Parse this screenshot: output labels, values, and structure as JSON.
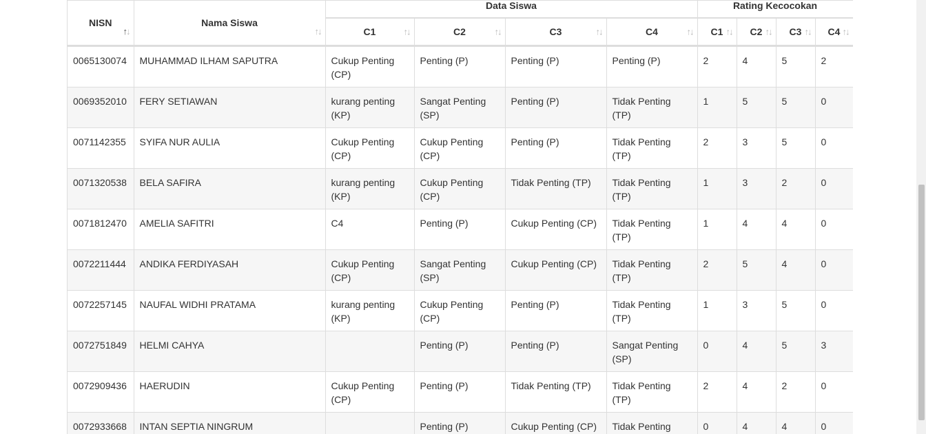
{
  "headers": {
    "nisn": "NISN",
    "nama": "Nama Siswa",
    "group_data": "Data Siswa",
    "group_rating": "Rating Kecocokan",
    "data_cols": [
      "C1",
      "C2",
      "C3",
      "C4"
    ],
    "rating_cols": [
      "C1",
      "C2",
      "C3",
      "C4"
    ],
    "sort_icon": "sort-arrows-icon"
  },
  "rows": [
    {
      "nisn": "0065130074",
      "nama": "MUHAMMAD ILHAM SAPUTRA",
      "c1": "Cukup Penting (CP)",
      "c2": "Penting (P)",
      "c3": "Penting (P)",
      "c4": "Penting (P)",
      "r1": "2",
      "r2": "4",
      "r3": "5",
      "r4": "2"
    },
    {
      "nisn": "0069352010",
      "nama": "FERY SETIAWAN",
      "c1": "kurang penting (KP)",
      "c2": "Sangat Penting (SP)",
      "c3": "Penting (P)",
      "c4": "Tidak Penting (TP)",
      "r1": "1",
      "r2": "5",
      "r3": "5",
      "r4": "0"
    },
    {
      "nisn": "0071142355",
      "nama": "SYIFA NUR AULIA",
      "c1": "Cukup Penting (CP)",
      "c2": "Cukup Penting (CP)",
      "c3": "Penting (P)",
      "c4": "Tidak Penting (TP)",
      "r1": "2",
      "r2": "3",
      "r3": "5",
      "r4": "0"
    },
    {
      "nisn": "0071320538",
      "nama": "BELA SAFIRA",
      "c1": "kurang penting (KP)",
      "c2": "Cukup Penting (CP)",
      "c3": "Tidak Penting (TP)",
      "c4": "Tidak Penting (TP)",
      "r1": "1",
      "r2": "3",
      "r3": "2",
      "r4": "0"
    },
    {
      "nisn": "0071812470",
      "nama": "AMELIA SAFITRI",
      "c1": "C4",
      "c2": "Penting (P)",
      "c3": "Cukup Penting (CP)",
      "c4": "Tidak Penting (TP)",
      "r1": "1",
      "r2": "4",
      "r3": "4",
      "r4": "0"
    },
    {
      "nisn": "0072211444",
      "nama": "ANDIKA FERDIYASAH",
      "c1": "Cukup Penting (CP)",
      "c2": "Sangat Penting (SP)",
      "c3": "Cukup Penting (CP)",
      "c4": "Tidak Penting (TP)",
      "r1": "2",
      "r2": "5",
      "r3": "4",
      "r4": "0"
    },
    {
      "nisn": "0072257145",
      "nama": "NAUFAL WIDHI PRATAMA",
      "c1": "kurang penting (KP)",
      "c2": "Cukup Penting (CP)",
      "c3": "Penting (P)",
      "c4": "Tidak Penting (TP)",
      "r1": "1",
      "r2": "3",
      "r3": "5",
      "r4": "0"
    },
    {
      "nisn": "0072751849",
      "nama": "HELMI CAHYA",
      "c1": "",
      "c2": "Penting (P)",
      "c3": "Penting (P)",
      "c4": "Sangat Penting (SP)",
      "r1": "0",
      "r2": "4",
      "r3": "5",
      "r4": "3"
    },
    {
      "nisn": "0072909436",
      "nama": "HAERUDIN",
      "c1": "Cukup Penting (CP)",
      "c2": "Penting (P)",
      "c3": "Tidak Penting (TP)",
      "c4": "Tidak Penting (TP)",
      "r1": "2",
      "r2": "4",
      "r3": "2",
      "r4": "0"
    },
    {
      "nisn": "0072933668",
      "nama": "INTAN SEPTIA NINGRUM",
      "c1": "",
      "c2": "Penting (P)",
      "c3": "Cukup Penting (CP)",
      "c4": "Tidak Penting (TP)",
      "r1": "0",
      "r2": "4",
      "r3": "4",
      "r4": "0"
    }
  ]
}
